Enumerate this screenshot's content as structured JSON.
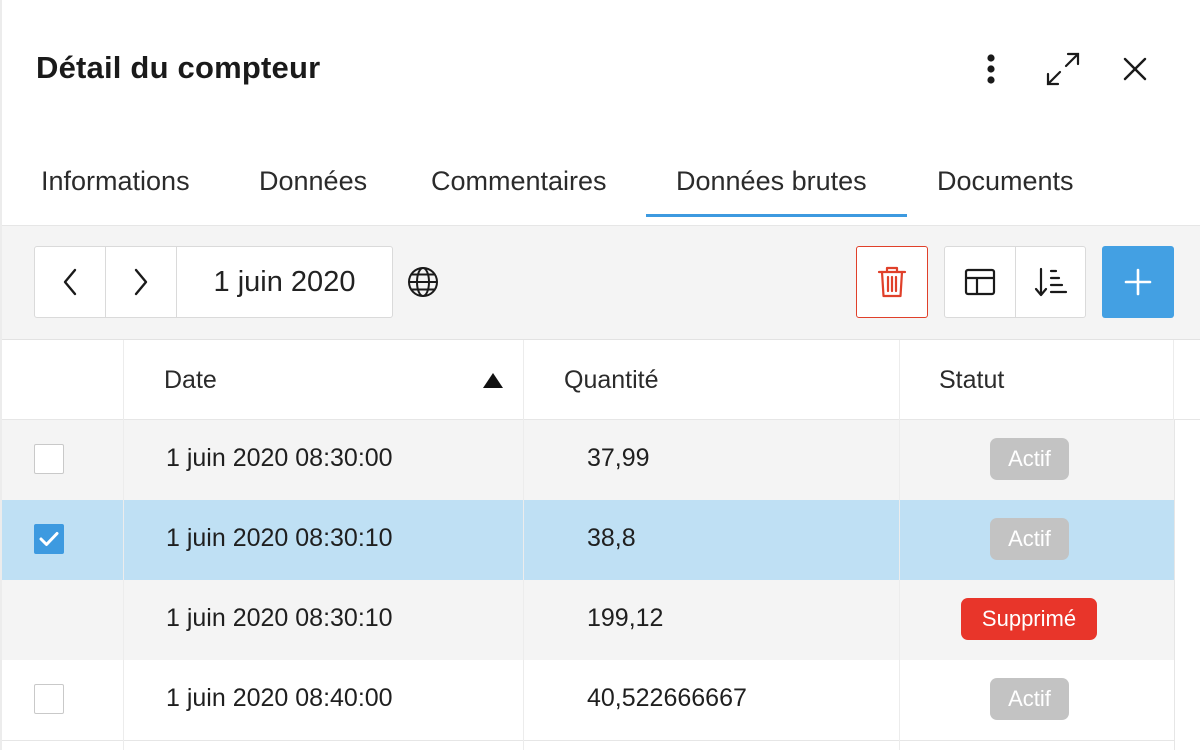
{
  "header": {
    "title": "Détail du compteur",
    "more_icon": "more-vertical-icon",
    "expand_icon": "expand-icon",
    "close_icon": "close-icon"
  },
  "tabs": [
    {
      "label": "Informations",
      "active": false
    },
    {
      "label": "Données",
      "active": false
    },
    {
      "label": "Commentaires",
      "active": false
    },
    {
      "label": "Données brutes",
      "active": true
    },
    {
      "label": "Documents",
      "active": false
    }
  ],
  "toolbar": {
    "prev_icon": "chevron-left-icon",
    "next_icon": "chevron-right-icon",
    "date": "1 juin 2020",
    "timezone_icon": "globe-icon",
    "delete_icon": "trash-icon",
    "columns_icon": "columns-layout-icon",
    "sort_icon": "sort-descending-icon",
    "add_icon": "plus-icon"
  },
  "table": {
    "columns": [
      "Date",
      "Quantité",
      "Statut"
    ],
    "sort": {
      "column": "Date",
      "direction": "ascending"
    },
    "rows": [
      {
        "date": "1 juin 2020 08:30:00",
        "quantity": "37,99",
        "status": "Actif",
        "checked": false,
        "selectable": true
      },
      {
        "date": "1 juin 2020 08:30:10",
        "quantity": "38,8",
        "status": "Actif",
        "checked": true,
        "selectable": true
      },
      {
        "date": "1 juin 2020 08:30:10",
        "quantity": "199,12",
        "status": "Supprimé",
        "checked": false,
        "selectable": false
      },
      {
        "date": "1 juin 2020 08:40:00",
        "quantity": "40,522666667",
        "status": "Actif",
        "checked": false,
        "selectable": true
      }
    ]
  },
  "colors": {
    "accent": "#3d9ae0",
    "selected_row": "#bfe0f4",
    "danger": "#e8352a",
    "badge_inactive": "#c3c3c3",
    "add_button": "#43a0e3"
  }
}
